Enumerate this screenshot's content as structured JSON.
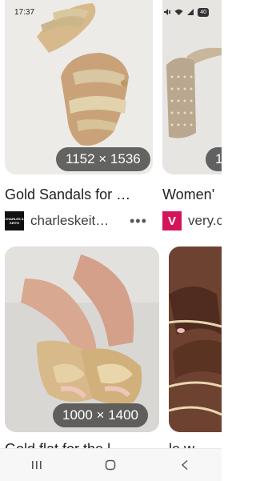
{
  "status": {
    "time": "17:37",
    "signal_text": "\u0004",
    "battery": "40"
  },
  "cards": [
    {
      "dimensions": "1152 × 1536",
      "title": "Gold Sandals for …",
      "source": "charleskeit…",
      "logo_text": "CHARLES & KEITH"
    },
    {
      "dimensions": "1",
      "title": "Women'",
      "source": "very.c",
      "logo_text": "V"
    },
    {
      "dimensions": "1000 × 1400",
      "title": "Gold flat for the l",
      "source": "",
      "logo_text": ""
    },
    {
      "dimensions": "",
      "title": "le w",
      "source": "",
      "logo_text": ""
    }
  ],
  "more_label": "•••",
  "nav": {
    "recents": "recents-button",
    "home": "home-button",
    "back": "back-button"
  },
  "colors": {
    "very_logo": "#d4145a",
    "badge_bg": "#3c3c3c"
  }
}
